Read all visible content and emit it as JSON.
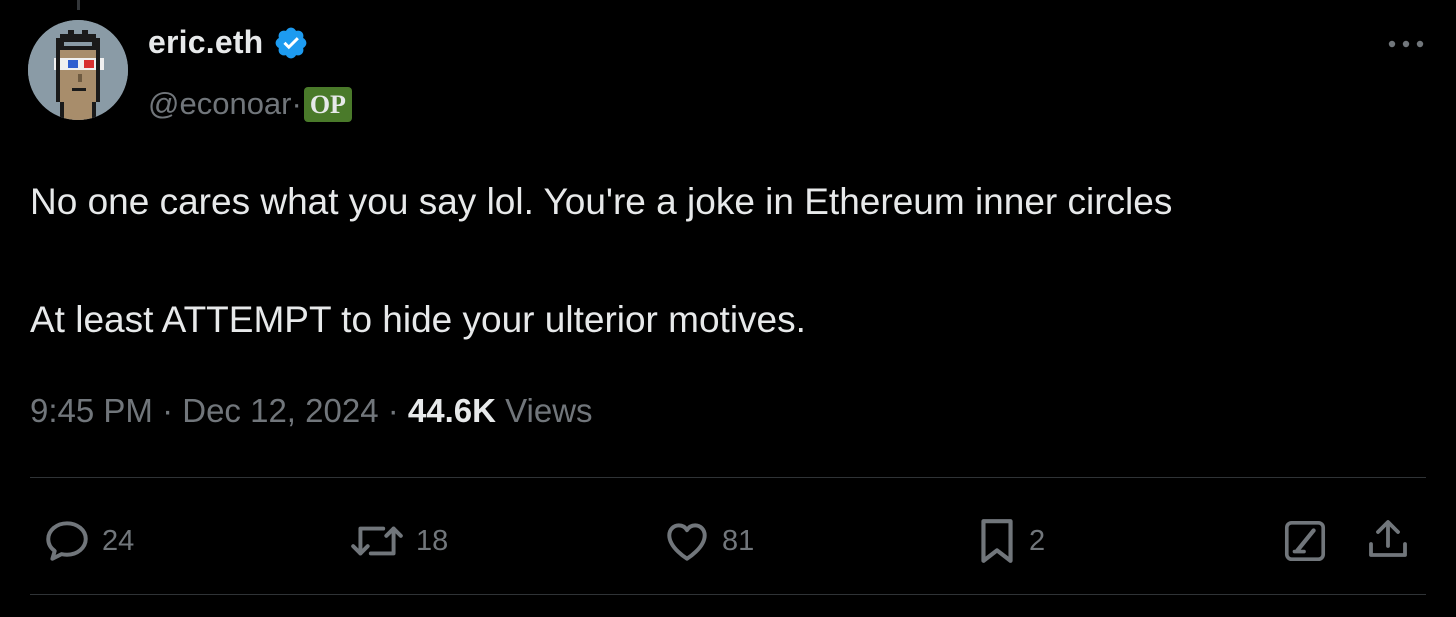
{
  "tweet": {
    "author": {
      "display_name": "eric.eth",
      "handle": "@econoar",
      "separator": "·",
      "badge": "OP",
      "verified": true,
      "avatar_icon": "pixel-punk-avatar-3d-glasses"
    },
    "text": {
      "paragraph1": "No one cares what you say lol. You're a joke in Ethereum inner circles",
      "paragraph2": "At least ATTEMPT to hide your ulterior motives."
    },
    "meta": {
      "time": "9:45 PM",
      "separator1": " · ",
      "date": "Dec 12, 2024",
      "separator2": " · ",
      "views_count": "44.6K",
      "views_label": " Views"
    },
    "actions": {
      "replies": "24",
      "reposts": "18",
      "likes": "81",
      "bookmarks": "2"
    },
    "icons": {
      "more": "more-horizontal-icon",
      "reply": "reply-icon",
      "repost": "repost-icon",
      "like": "heart-icon",
      "bookmark": "bookmark-icon",
      "grok": "grok-icon",
      "share": "share-icon"
    }
  },
  "colors": {
    "background": "#000000",
    "text_primary": "#e7e9ea",
    "text_secondary": "#71767b",
    "divider": "#2f3336",
    "verified": "#1d9bf0",
    "op_badge": "#4a7a2a"
  }
}
